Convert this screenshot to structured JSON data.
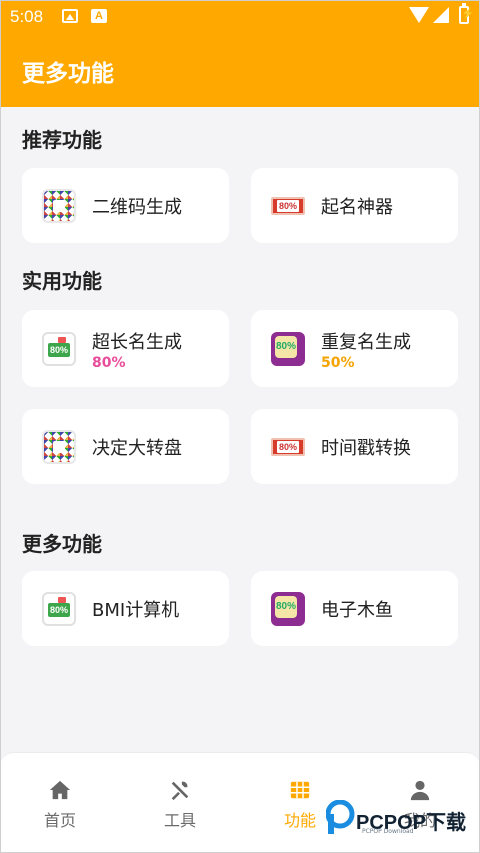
{
  "status_bar": {
    "time": "5:08",
    "notif_a": "A",
    "battery_glyph": "⚡"
  },
  "app_bar": {
    "title": "更多功能"
  },
  "sections": {
    "recommended": {
      "title": "推荐功能",
      "items": [
        {
          "label": "二维码生成",
          "icon": "qr-code-icon"
        },
        {
          "label": "起名神器",
          "icon": "ticket-icon",
          "icon_text": "80%"
        }
      ]
    },
    "practical": {
      "title": "实用功能",
      "items": [
        {
          "label": "超长名生成",
          "percent": "80%",
          "percent_color": "#e84c9a",
          "icon": "badge-icon",
          "icon_text": "80%"
        },
        {
          "label": "重复名生成",
          "percent": "50%",
          "percent_color": "#f5a300",
          "icon": "purple-badge-icon",
          "icon_text": "80%"
        },
        {
          "label": "决定大转盘",
          "icon": "qr-code-icon"
        },
        {
          "label": "时间戳转换",
          "icon": "ticket-icon",
          "icon_text": "80%"
        }
      ]
    },
    "more": {
      "title": "更多功能",
      "items": [
        {
          "label": "BMI计算机",
          "icon": "badge-icon",
          "icon_text": "80%"
        },
        {
          "label": "电子木鱼",
          "icon": "purple-badge-icon",
          "icon_text": "80%"
        }
      ]
    }
  },
  "bottom_nav": {
    "items": [
      {
        "label": "首页",
        "icon": "home-icon"
      },
      {
        "label": "工具",
        "icon": "tools-icon"
      },
      {
        "label": "功能",
        "icon": "grid-icon",
        "active": true
      },
      {
        "label": "我的",
        "icon": "user-icon"
      }
    ]
  },
  "watermark": {
    "text": "PCPOP下载",
    "sub": "PCPOP Download"
  },
  "colors": {
    "accent": "#ffa900",
    "background": "#f4f4f6",
    "card": "#ffffff"
  }
}
